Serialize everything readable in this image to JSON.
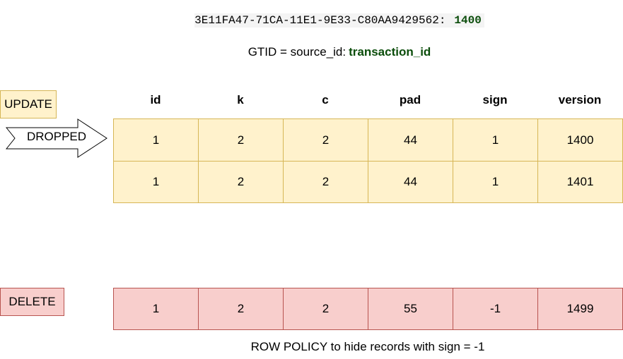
{
  "gtid_example": {
    "source_id": "3E11FA47-71CA-11E1-9E33-C80AA9429562:",
    "transaction_id": "1400"
  },
  "gtid_definition": {
    "prefix": "GTID = source_id:",
    "transaction_id": "transaction_id"
  },
  "labels": {
    "update": "UPDATE",
    "delete": "DELETE",
    "dropped": "DROPPED"
  },
  "columns": [
    "id",
    "k",
    "c",
    "pad",
    "sign",
    "version"
  ],
  "update_rows": [
    [
      "1",
      "2",
      "2",
      "44",
      "1",
      "1400"
    ],
    [
      "1",
      "2",
      "2",
      "44",
      "1",
      "1401"
    ]
  ],
  "delete_rows": [
    [
      "1",
      "2",
      "2",
      "55",
      "-1",
      "1499"
    ]
  ],
  "policy_note": "ROW POLICY to hide records with sign = -1",
  "colors": {
    "yellow_fill": "#fff2cc",
    "yellow_stroke": "#d6b656",
    "red_fill": "#f8cecc",
    "red_stroke": "#b85450",
    "txn_green": "#0b4d0b"
  }
}
